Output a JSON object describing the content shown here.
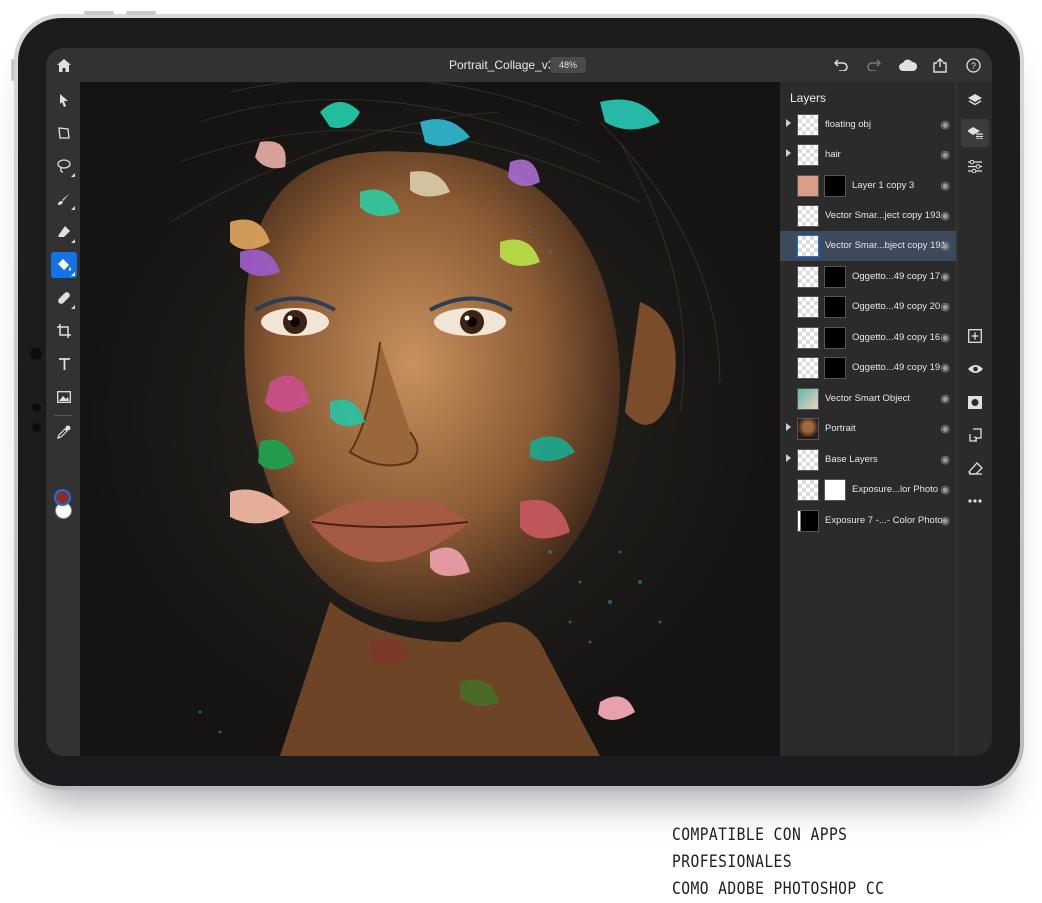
{
  "app": {
    "document_title": "Portrait_Collage_v3",
    "zoom": "48%"
  },
  "topbar": {
    "home": "home-icon",
    "undo": "undo-icon",
    "redo": "redo-icon",
    "cloud": "cloud-icon",
    "share": "share-icon",
    "help": "help-icon"
  },
  "tools": [
    {
      "name": "select-tool",
      "icon": "arrow-icon"
    },
    {
      "name": "transform-tool",
      "icon": "transform-icon"
    },
    {
      "name": "lasso-tool",
      "icon": "lasso-icon"
    },
    {
      "name": "brush-tool",
      "icon": "brush-icon"
    },
    {
      "name": "eraser-tool",
      "icon": "eraser-icon"
    },
    {
      "name": "fill-tool",
      "icon": "paint-bucket-icon",
      "active": true
    },
    {
      "name": "healing-tool",
      "icon": "bandage-icon"
    },
    {
      "name": "crop-tool",
      "icon": "crop-icon"
    },
    {
      "name": "type-tool",
      "icon": "type-icon"
    },
    {
      "name": "image-tool",
      "icon": "image-icon"
    },
    {
      "name": "eyedropper-tool",
      "icon": "eyedropper-icon"
    }
  ],
  "colors": {
    "foreground": "#8a2e2c",
    "background": "#ffffff",
    "accent": "#1473e6"
  },
  "layers_panel": {
    "title": "Layers",
    "layers": [
      {
        "name": "floating obj",
        "group": true
      },
      {
        "name": "hair",
        "group": true
      },
      {
        "name": "Layer 1 copy 3",
        "mask": true
      },
      {
        "name": "Vector Smar...ject copy 193"
      },
      {
        "name": "Vector Smar...bject copy 191",
        "selected": true
      },
      {
        "name": "Oggetto...49 copy 17",
        "mask": true
      },
      {
        "name": "Oggetto...49 copy 20",
        "mask": true
      },
      {
        "name": "Oggetto...49 copy 16",
        "mask": true
      },
      {
        "name": "Oggetto...49 copy 19",
        "mask": true
      },
      {
        "name": "Vector Smart Object"
      },
      {
        "name": "Portrait",
        "group": true
      },
      {
        "name": "Base Layers",
        "group": true
      },
      {
        "name": "Exposure...lor Photo",
        "mask": true
      },
      {
        "name": "Exposure 7 -...- Color Photo"
      }
    ]
  },
  "rail": [
    "layers-icon",
    "layer-properties-icon",
    "adjustments-icon",
    "add-layer-icon",
    "visibility-icon",
    "mask-icon",
    "merge-icon",
    "eraser-layer-icon",
    "more-icon"
  ],
  "caption": {
    "line1": "COMPATIBLE CON APPS PROFESIONALES",
    "line2": "COMO ADOBE PHOTOSHOP CC"
  }
}
